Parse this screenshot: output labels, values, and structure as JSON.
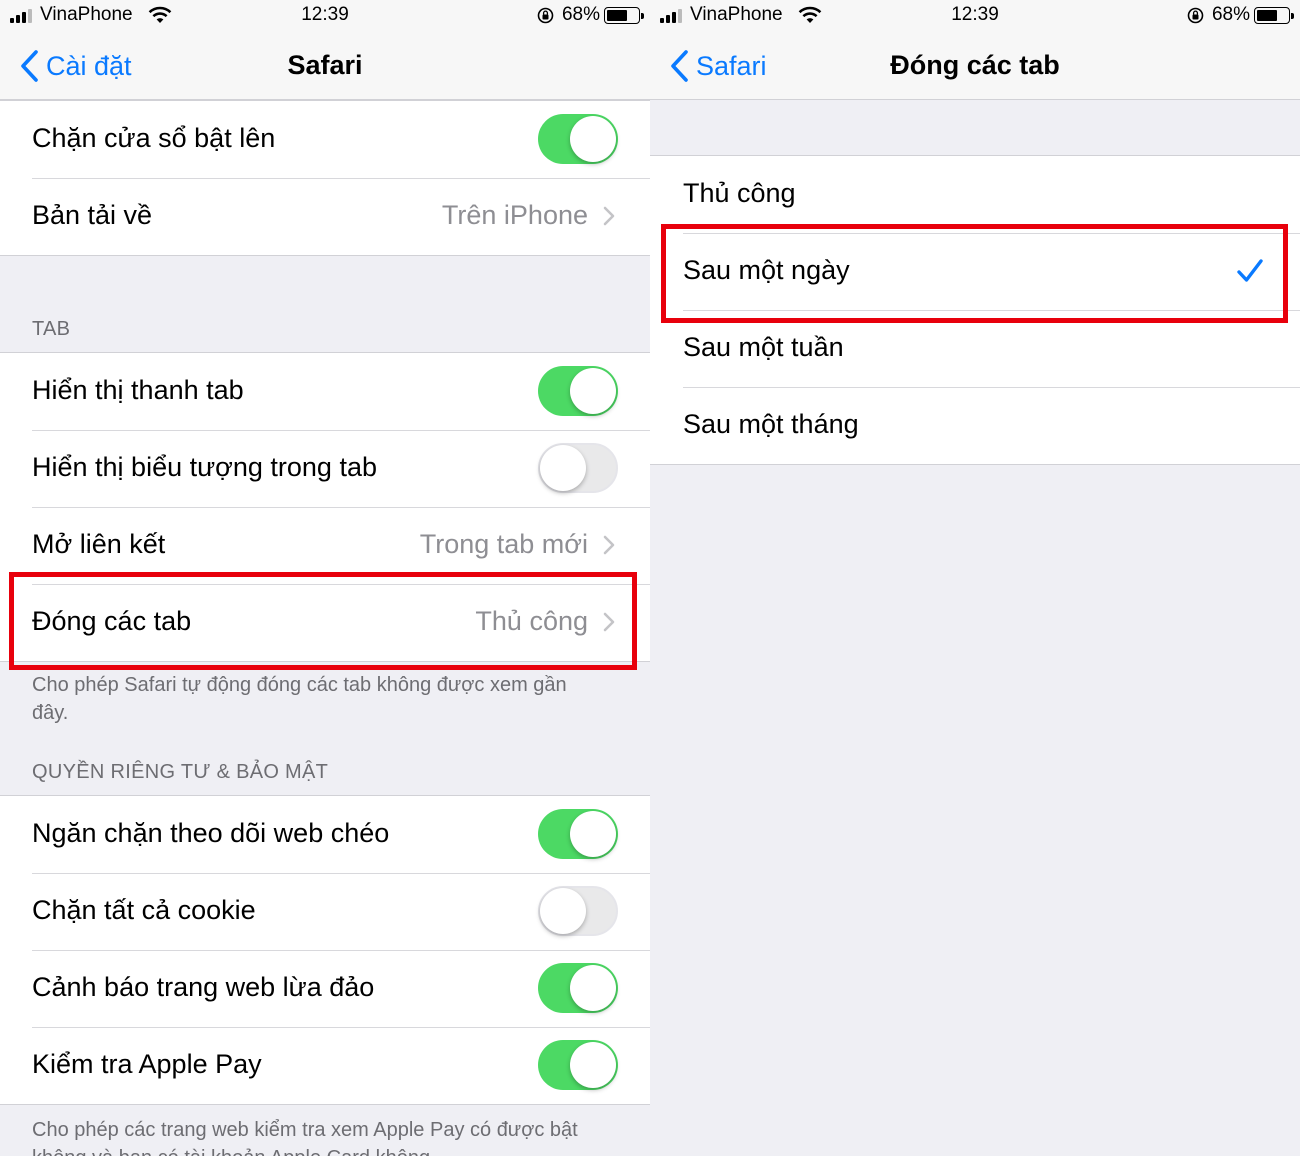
{
  "colors": {
    "accent": "#0a7aff",
    "toggle_on": "#4cd964",
    "highlight": "#e8000c"
  },
  "left": {
    "status": {
      "carrier": "VinaPhone",
      "time": "12:39",
      "battery": "68%",
      "battery_level": 0.68
    },
    "nav": {
      "back_label": "Cài đặt",
      "title": "Safari"
    },
    "group_top": [
      {
        "label": "Chặn cửa sổ bật lên",
        "toggle": true
      },
      {
        "label": "Bản tải về",
        "value": "Trên iPhone"
      }
    ],
    "tab_section": {
      "header": "TAB",
      "rows": [
        {
          "label": "Hiển thị thanh tab",
          "toggle": true
        },
        {
          "label": "Hiển thị biểu tượng trong tab",
          "toggle": false
        },
        {
          "label": "Mở liên kết",
          "value": "Trong tab mới"
        },
        {
          "label": "Đóng các tab",
          "value": "Thủ công"
        }
      ],
      "footnote": "Cho phép Safari tự động đóng các tab không được xem gần đây."
    },
    "privacy_section": {
      "header": "QUYỀN RIÊNG TƯ & BẢO MẬT",
      "rows": [
        {
          "label": "Ngăn chặn theo dõi web chéo",
          "toggle": true
        },
        {
          "label": "Chặn tất cả cookie",
          "toggle": false
        },
        {
          "label": "Cảnh báo trang web lừa đảo",
          "toggle": true
        },
        {
          "label": "Kiểm tra Apple Pay",
          "toggle": true
        }
      ],
      "footnote": "Cho phép các trang web kiểm tra xem Apple Pay có được bật không và bạn có tài khoản Apple Card không."
    }
  },
  "right": {
    "status": {
      "carrier": "VinaPhone",
      "time": "12:39",
      "battery": "68%",
      "battery_level": 0.68
    },
    "nav": {
      "back_label": "Safari",
      "title": "Đóng các tab"
    },
    "options": [
      {
        "label": "Thủ công",
        "selected": false
      },
      {
        "label": "Sau một ngày",
        "selected": true
      },
      {
        "label": "Sau một tuần",
        "selected": false
      },
      {
        "label": "Sau một tháng",
        "selected": false
      }
    ]
  }
}
